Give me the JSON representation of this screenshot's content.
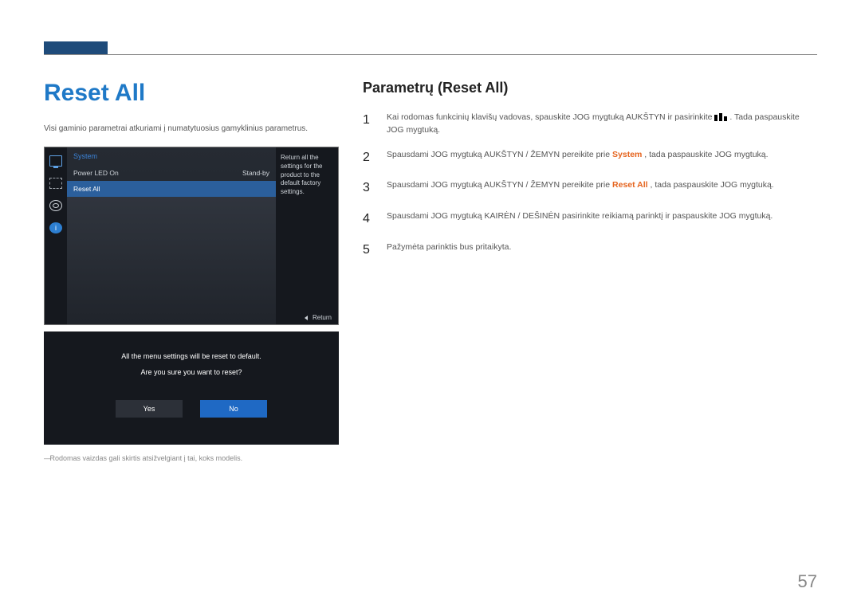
{
  "page_number": "57",
  "left": {
    "heading": "Reset All",
    "intro": "Visi gaminio parametrai atkuriami į numatytuosius gamyklinius parametrus.",
    "osd": {
      "title": "System",
      "row_power_label": "Power LED On",
      "row_power_value": "Stand-by",
      "row_reset": "Reset All",
      "side_text": "Return all the settings for the product to the default factory settings.",
      "footer": "Return"
    },
    "dialog": {
      "line1": "All the menu settings will be reset to default.",
      "line2": "Are you sure you want to reset?",
      "yes": "Yes",
      "no": "No"
    },
    "footnote": "Rodomas vaizdas gali skirtis atsižvelgiant į tai, koks modelis."
  },
  "right": {
    "heading": "Parametrų (Reset All)",
    "steps": {
      "s1a": "Kai rodomas funkcinių klavišų vadovas, spauskite JOG mygtuką AUKŠTYN ir pasirinkite ",
      "s1b": ". Tada paspauskite JOG mygtuką.",
      "s2a": "Spausdami JOG mygtuką AUKŠTYN / ŽEMYN pereikite prie ",
      "s2_system": "System",
      "s2b": ", tada paspauskite JOG mygtuką.",
      "s3a": "Spausdami JOG mygtuką AUKŠTYN / ŽEMYN pereikite prie ",
      "s3_reset": "Reset All",
      "s3b": ", tada paspauskite JOG mygtuką.",
      "s4": "Spausdami JOG mygtuką KAIRĖN / DEŠINĖN pasirinkite reikiamą parinktį ir paspauskite JOG mygtuką.",
      "s5": "Pažymėta parinktis bus pritaikyta."
    }
  }
}
